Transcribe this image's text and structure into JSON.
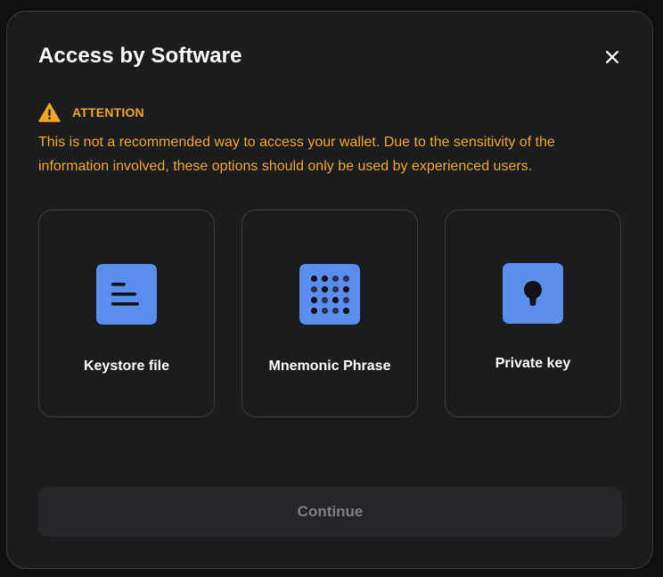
{
  "modal": {
    "title": "Access by Software"
  },
  "attention": {
    "label": "ATTENTION",
    "text": "This is not a recommended way to access your wallet. Due to the sensitivity of the information involved, these options should only be used by experienced users."
  },
  "options": [
    {
      "label": "Keystore file",
      "icon": "keystore-file-icon"
    },
    {
      "label": "Mnemonic Phrase",
      "icon": "mnemonic-grid-icon"
    },
    {
      "label": "Private key",
      "icon": "keyhole-icon"
    }
  ],
  "footer": {
    "continue_label": "Continue",
    "continue_state": "disabled"
  },
  "colors": {
    "background": "#1b1c1e",
    "border": "#3a3b3e",
    "warning": "#f5a623",
    "icon_accent": "#5b8def",
    "button_disabled_bg": "#25262a",
    "button_disabled_text": "#7d7f84"
  }
}
